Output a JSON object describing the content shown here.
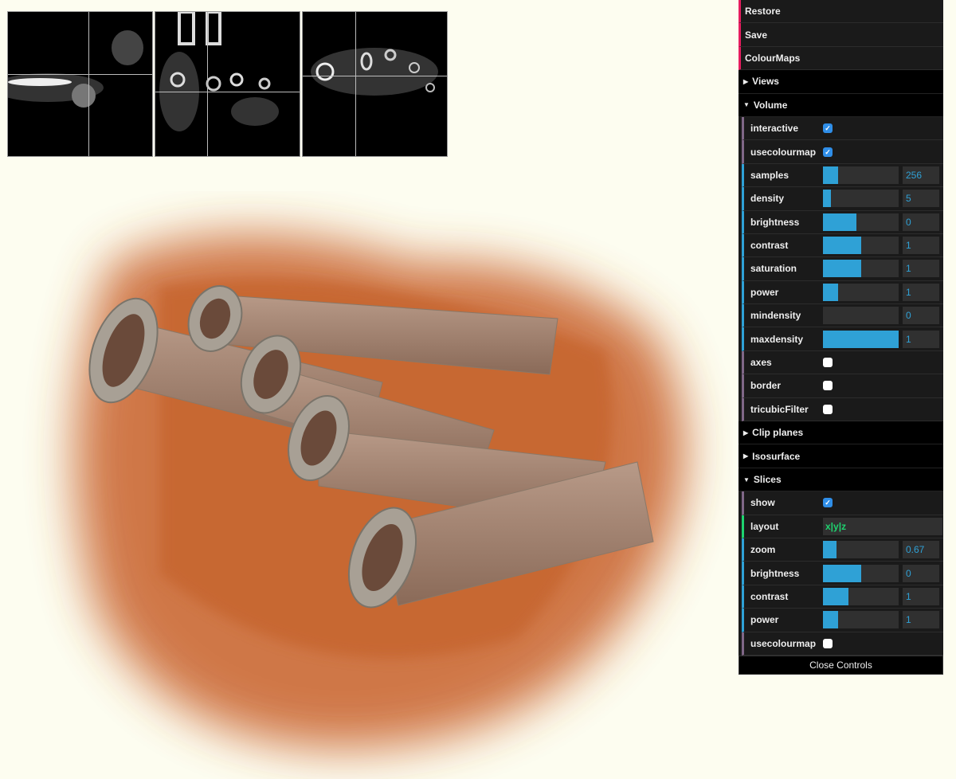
{
  "gui": {
    "buttons": [
      "Restore",
      "Save",
      "ColourMaps"
    ],
    "folders": {
      "views": "Views",
      "volume": "Volume",
      "clip": "Clip planes",
      "iso": "Isosurface",
      "slices": "Slices"
    },
    "volume": [
      {
        "label": "interactive",
        "type": "bool",
        "checked": true
      },
      {
        "label": "usecolourmap",
        "type": "bool",
        "checked": true
      },
      {
        "label": "samples",
        "type": "num",
        "value": "256",
        "fill": 0.2
      },
      {
        "label": "density",
        "type": "num",
        "value": "5",
        "fill": 0.1
      },
      {
        "label": "brightness",
        "type": "num",
        "value": "0",
        "fill": 0.44
      },
      {
        "label": "contrast",
        "type": "num",
        "value": "1",
        "fill": 0.5
      },
      {
        "label": "saturation",
        "type": "num",
        "value": "1",
        "fill": 0.5
      },
      {
        "label": "power",
        "type": "num",
        "value": "1",
        "fill": 0.2
      },
      {
        "label": "mindensity",
        "type": "num",
        "value": "0",
        "fill": 0
      },
      {
        "label": "maxdensity",
        "type": "num",
        "value": "1",
        "fill": 1
      },
      {
        "label": "axes",
        "type": "bool",
        "checked": false
      },
      {
        "label": "border",
        "type": "bool",
        "checked": false
      },
      {
        "label": "tricubicFilter",
        "type": "bool",
        "checked": false
      }
    ],
    "slices": [
      {
        "label": "show",
        "type": "bool",
        "checked": true
      },
      {
        "label": "layout",
        "type": "str",
        "value": "x|y|z"
      },
      {
        "label": "zoom",
        "type": "num",
        "value": "0.67",
        "fill": 0.18
      },
      {
        "label": "brightness",
        "type": "num",
        "value": "0",
        "fill": 0.5
      },
      {
        "label": "contrast",
        "type": "num",
        "value": "1",
        "fill": 0.34
      },
      {
        "label": "power",
        "type": "num",
        "value": "1",
        "fill": 0.2
      },
      {
        "label": "usecolourmap",
        "type": "bool",
        "checked": false
      }
    ],
    "close": "Close Controls"
  },
  "colors": {
    "accent": "#2fa1d6",
    "button": "#e61d5f",
    "string": "#1ed36f",
    "background": "#fdfdf0"
  }
}
